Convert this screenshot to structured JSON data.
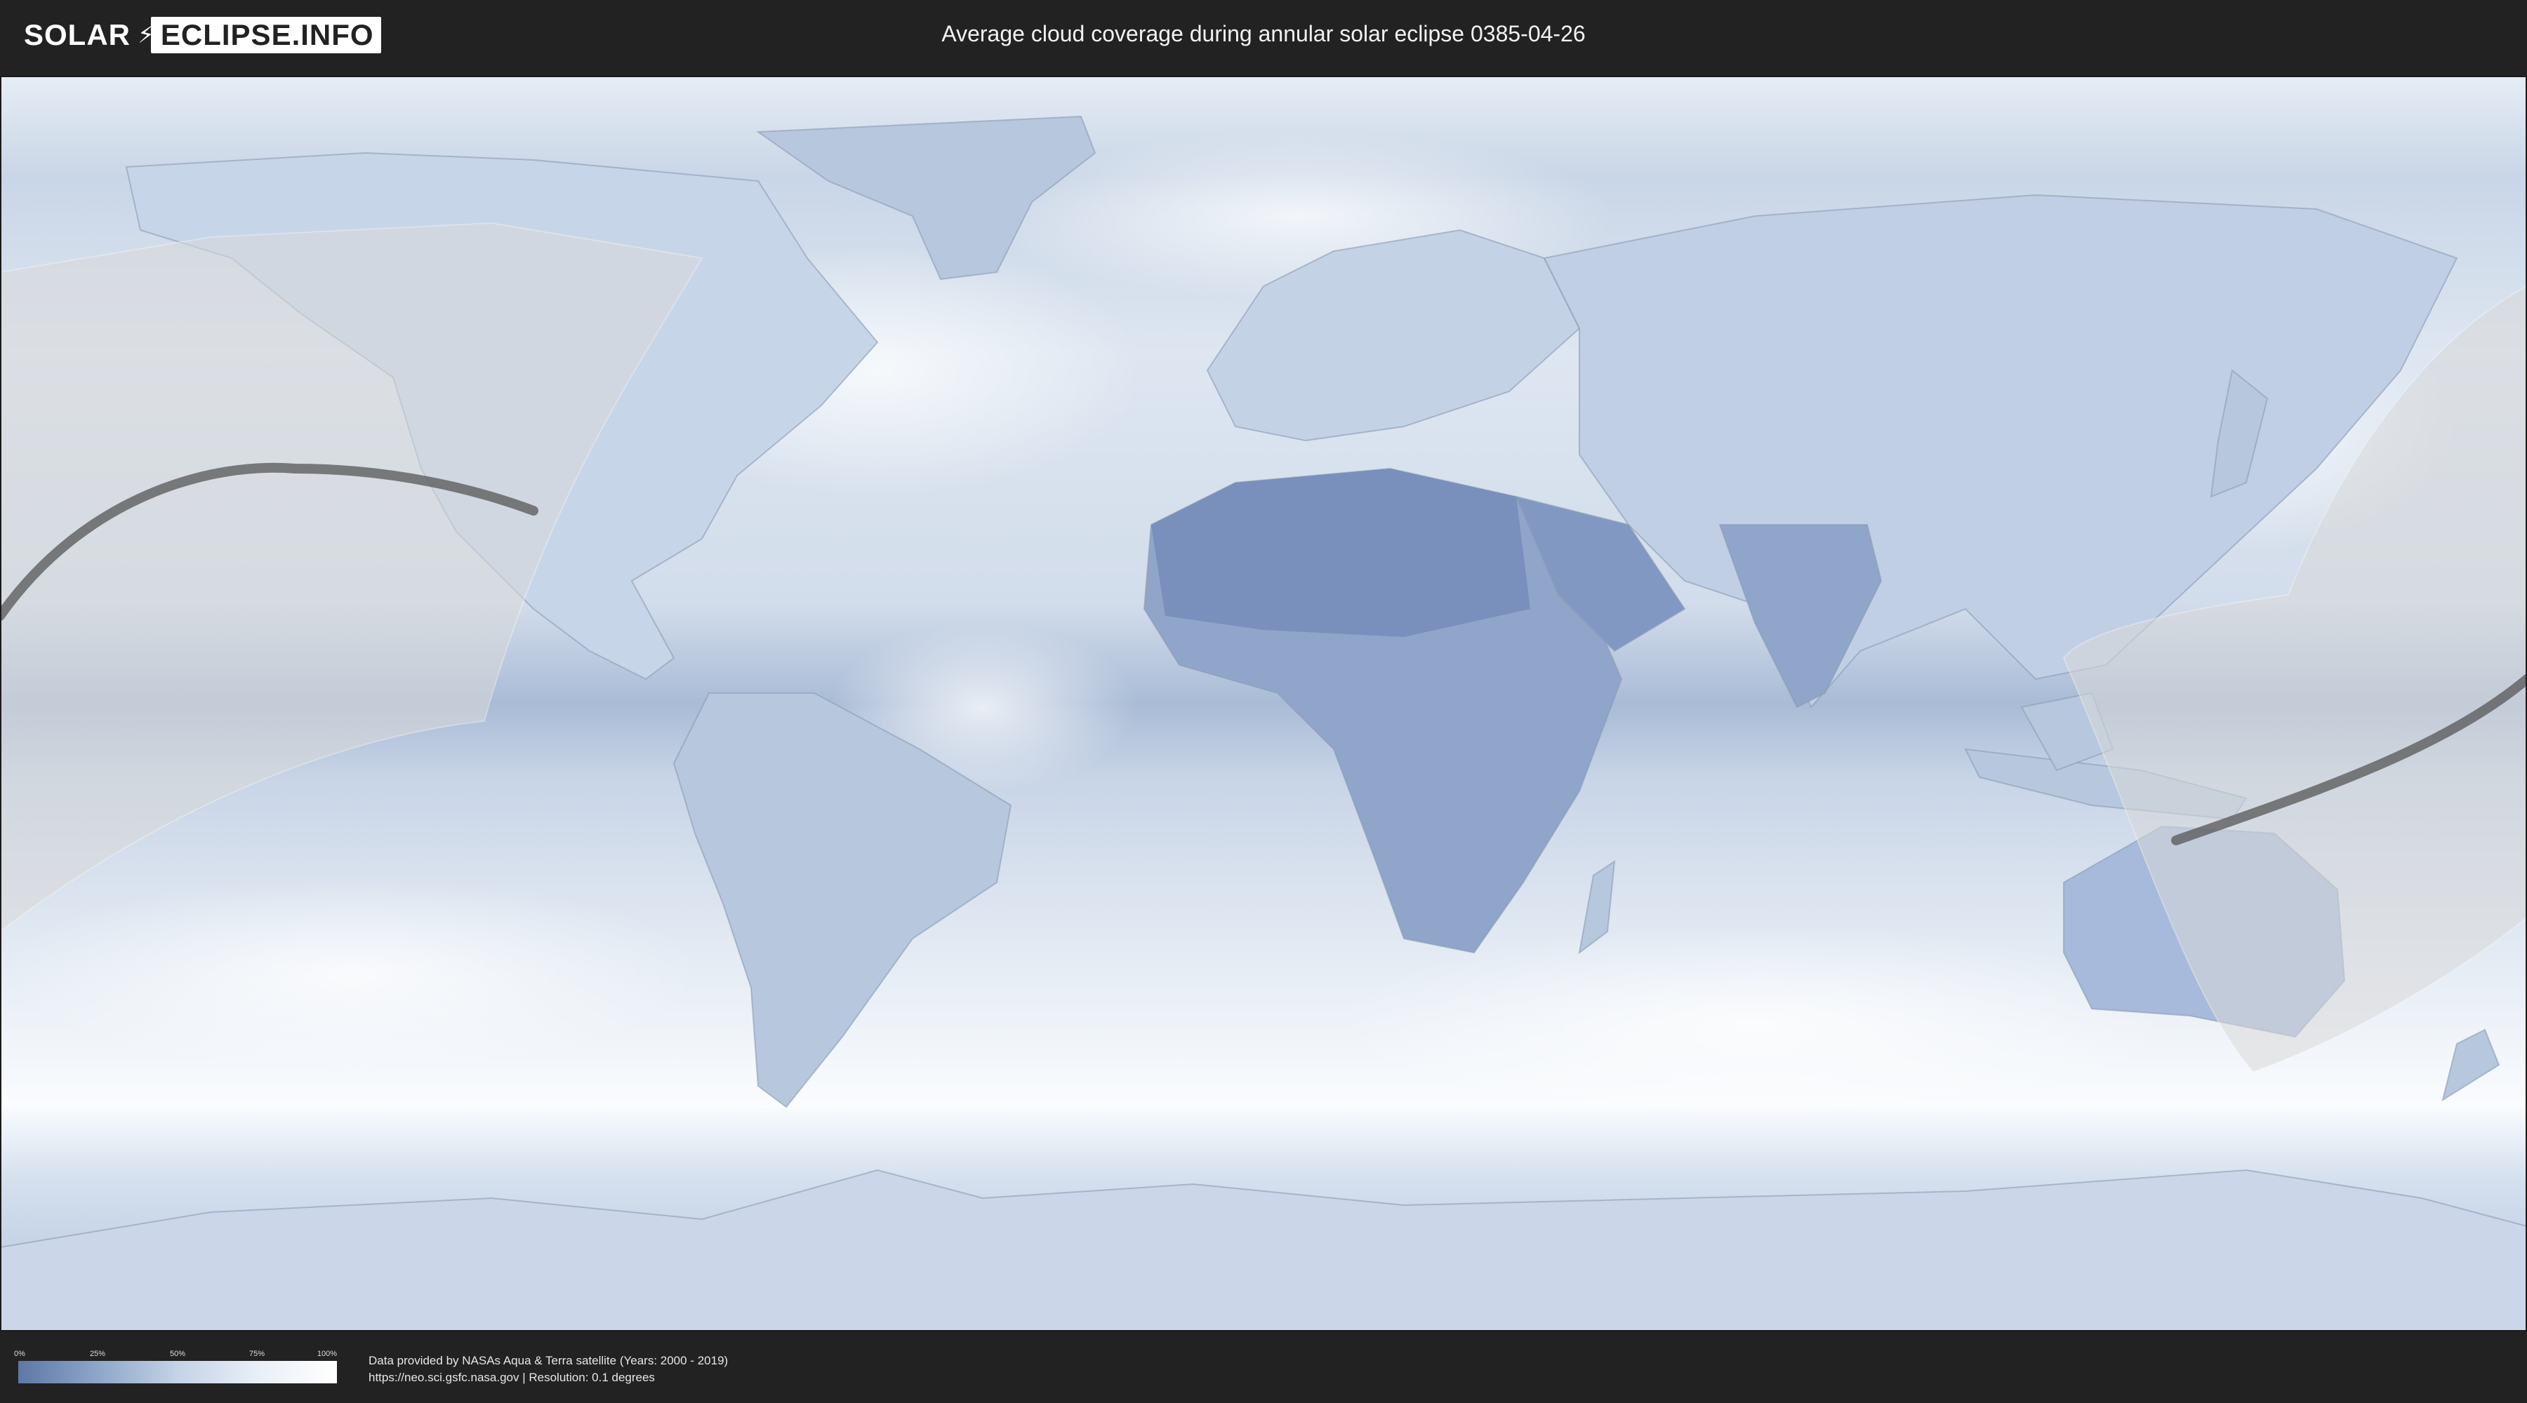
{
  "header": {
    "logo_left": "SOLAR",
    "logo_right": "ECLIPSE.INFO",
    "logo_icon": "lightning-bolt-icon",
    "title": "Average cloud coverage during annular solar eclipse 0385-04-26"
  },
  "map": {
    "projection": "equirectangular",
    "layer": "average cloud coverage",
    "colors": {
      "clear": "#5e78a6",
      "cloudy": "#ffffff",
      "eclipse_band_fill": "#d8d8d8",
      "central_line": "#555555"
    }
  },
  "legend": {
    "ticks": [
      {
        "label": "0%",
        "value": 0
      },
      {
        "label": "25%",
        "value": 0.25
      },
      {
        "label": "50%",
        "value": 0.5
      },
      {
        "label": "75%",
        "value": 0.75
      },
      {
        "label": "100%",
        "value": 1
      }
    ]
  },
  "footer": {
    "credit_line1": "Data provided by NASAs Aqua & Terra satellite (Years: 2000 - 2019)",
    "credit_line2": "https://neo.sci.gsfc.nasa.gov | Resolution: 0.1 degrees"
  }
}
